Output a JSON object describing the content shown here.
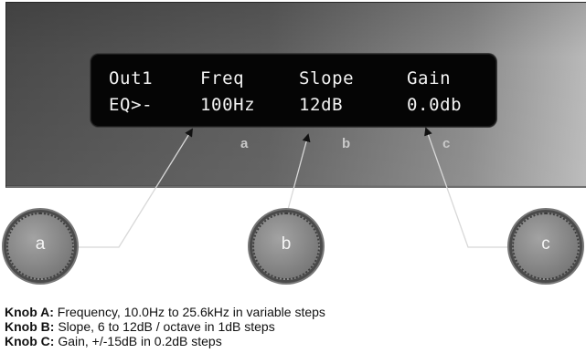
{
  "display": {
    "row1": [
      "Out1",
      "Freq",
      "Slope",
      "Gain"
    ],
    "row2": [
      "EQ>-",
      "100Hz",
      "12dB",
      "0.0db"
    ]
  },
  "panel_labels": [
    "a",
    "b",
    "c"
  ],
  "knobs": [
    {
      "letter": "a"
    },
    {
      "letter": "b"
    },
    {
      "letter": "c"
    }
  ],
  "legend": [
    {
      "term": "Knob A:",
      "text": " Frequency, 10.0Hz to 25.6kHz in variable steps"
    },
    {
      "term": "Knob B:",
      "text": " Slope, 6 to 12dB / octave in 1dB steps"
    },
    {
      "term": "Knob C:",
      "text": " Gain, +/-15dB in 0.2dB steps"
    }
  ]
}
